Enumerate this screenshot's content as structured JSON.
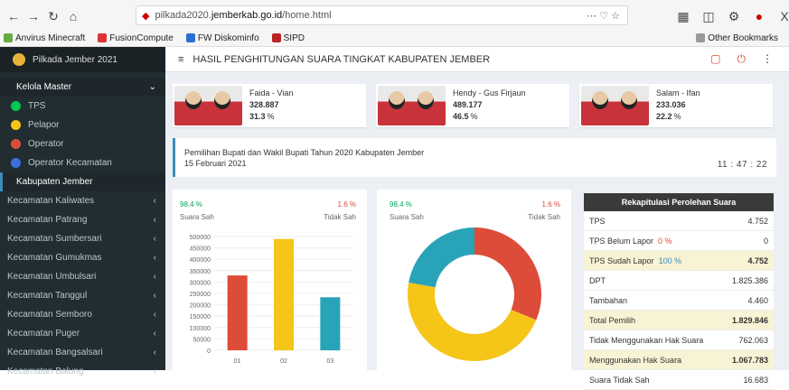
{
  "browser": {
    "url_prefix": "pilkada2020.",
    "url_host": "jemberkab.go.id",
    "url_path": "/home.html",
    "bookmarks": [
      "Anvirus Minecraft",
      "FusionCompute",
      "FW Diskominfo",
      "SIPD"
    ],
    "other_bookmarks": "Other Bookmarks"
  },
  "brand": "Pilkada Jember 2021",
  "sidebar": {
    "header": "Kelola Master",
    "master_items": [
      {
        "label": "TPS",
        "color": "#00c853"
      },
      {
        "label": "Pelapor",
        "color": "#f5c518"
      },
      {
        "label": "Operator",
        "color": "#dd4b39"
      },
      {
        "label": "Operator Kecamatan",
        "color": "#3c6fd8"
      }
    ],
    "active": "Kabupaten Jember",
    "kecamatan": [
      "Kecamatan Kaliwates",
      "Kecamatan Patrang",
      "Kecamatan Sumbersari",
      "Kecamatan Gumukmas",
      "Kecamatan Umbulsari",
      "Kecamatan Tanggul",
      "Kecamatan Semboro",
      "Kecamatan Puger",
      "Kecamatan Bangsalsari",
      "Kecamatan Balung"
    ]
  },
  "topbar": {
    "title": "HASIL PENGHITUNGAN SUARA TINGKAT KABUPATEN JEMBER"
  },
  "candidates": [
    {
      "name": "Faida - Vian",
      "votes": "328.887",
      "pct": "31.3",
      "pct_unit": "%",
      "bg": "#c8323a"
    },
    {
      "name": "Hendy - Gus Firjaun",
      "votes": "489.177",
      "pct": "46.5",
      "pct_unit": "%",
      "bg": "#c8323a"
    },
    {
      "name": "Salam - Ifan",
      "votes": "233.036",
      "pct": "22.2",
      "pct_unit": "%",
      "bg": "#c8323a"
    }
  ],
  "info": {
    "line1": "Pemilihan Bupati dan Wakil Bupati Tahun 2020 Kabupaten Jember",
    "line2": "15 Februari 2021",
    "clock": "11 : 47 : 22"
  },
  "bar_panel": {
    "sah_pct": "98.4 %",
    "sah_label": "Suara Sah",
    "tidak_pct": "1.6 %",
    "tidak_label": "Tidak Sah"
  },
  "donut_panel": {
    "sah_pct": "98.4 %",
    "sah_label": "Suara Sah",
    "tidak_pct": "1.6 %",
    "tidak_label": "Tidak Sah"
  },
  "chart_data": [
    {
      "type": "bar",
      "categories": [
        "01",
        "02",
        "03"
      ],
      "values": [
        328887,
        489177,
        233036
      ],
      "colors": [
        "#dd4b39",
        "#f5c518",
        "#29a3b8"
      ],
      "ylim": [
        0,
        500000
      ],
      "yticks": [
        0,
        50000,
        100000,
        150000,
        200000,
        250000,
        300000,
        350000,
        400000,
        450000,
        500000
      ],
      "grid": true
    },
    {
      "type": "pie",
      "donut": true,
      "values": [
        328887,
        489177,
        233036
      ],
      "colors": [
        "#dd4b39",
        "#f5c518",
        "#29a3b8"
      ]
    }
  ],
  "rekap": {
    "title": "Rekapitulasi Perolehan Suara",
    "rows": [
      {
        "label": "TPS",
        "value": "4.752"
      },
      {
        "label": "TPS Belum Lapor",
        "tag": "0 %",
        "tagcolor": "red",
        "value": "0"
      },
      {
        "label": "TPS Sudah Lapor",
        "tag": "100 %",
        "tagcolor": "blue",
        "value": "4.752",
        "hl": true,
        "bold": true
      },
      {
        "label": "DPT",
        "value": "1.825.386"
      },
      {
        "label": "Tambahan",
        "value": "4.460"
      },
      {
        "label": "Total Pemilih",
        "value": "1.829.846",
        "hl": true,
        "bold": true
      },
      {
        "label": "Tidak Menggunakan Hak Suara",
        "value": "762.063"
      },
      {
        "label": "Menggunakan Hak Suara",
        "value": "1.067.783",
        "hl": true,
        "bold": true
      },
      {
        "label": "Suara Tidak Sah",
        "value": "16.683"
      }
    ]
  }
}
